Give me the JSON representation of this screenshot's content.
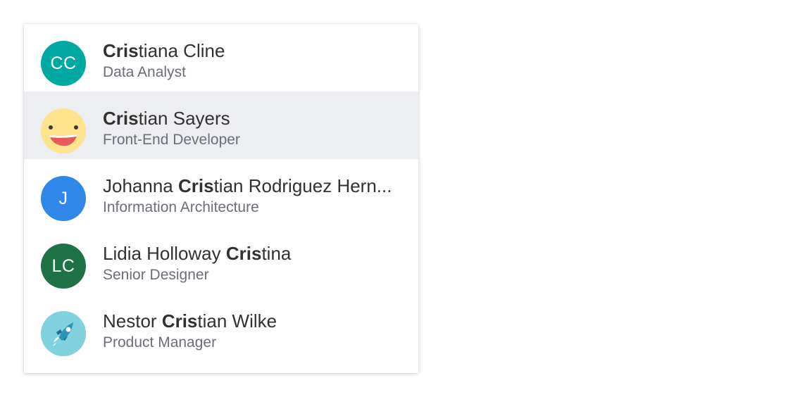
{
  "people": [
    {
      "name_before": "",
      "name_match": "Cris",
      "name_after": "tiana Cline",
      "role": "Data Analyst",
      "avatar_type": "initials",
      "initials": "CC",
      "avatar_color": "#00a8a3",
      "selected": false
    },
    {
      "name_before": "",
      "name_match": "Cris",
      "name_after": "tian Sayers",
      "role": "Front-End Developer",
      "avatar_type": "image",
      "image_icon": "smiley-face-icon",
      "selected": true
    },
    {
      "name_before": "Johanna ",
      "name_match": "Cris",
      "name_after": "tian Rodriguez Hern...",
      "role": "Information Architecture",
      "avatar_type": "initials",
      "initials": "J",
      "avatar_color": "#2f87e8",
      "selected": false
    },
    {
      "name_before": "Lidia Holloway ",
      "name_match": "Cris",
      "name_after": "tina",
      "role": "Senior Designer",
      "avatar_type": "initials",
      "initials": "LC",
      "avatar_color": "#1f7245",
      "selected": false
    },
    {
      "name_before": "Nestor ",
      "name_match": "Cris",
      "name_after": "tian Wilke",
      "role": "Product Manager",
      "avatar_type": "image",
      "image_icon": "rocket-icon",
      "selected": false
    }
  ],
  "colors": {
    "selected_bg": "#edeef1",
    "name_text": "#323130",
    "role_text": "#6b6e78"
  }
}
